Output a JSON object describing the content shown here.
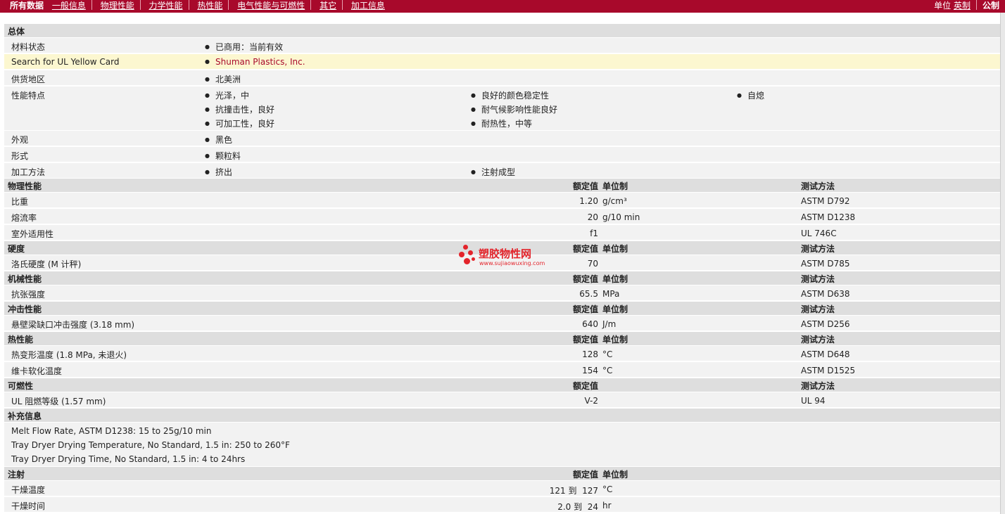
{
  "nav": {
    "all": "所有数据",
    "tabs": [
      "一般信息",
      "物理性能",
      "力学性能",
      "热性能",
      "电气性能与可燃性",
      "其它",
      "加工信息"
    ],
    "units_label": "单位",
    "imperial": "英制",
    "metric": "公制"
  },
  "headers": {
    "nominal": "额定值",
    "unit": "单位制",
    "method": "测试方法"
  },
  "general": {
    "title": "总体",
    "material_status": {
      "label": "材料状态",
      "value": "已商用：当前有效"
    },
    "ul_card": {
      "label": "Search for UL Yellow Card",
      "value": "Shuman Plastics, Inc."
    },
    "region": {
      "label": "供货地区",
      "value": "北美洲"
    },
    "features": {
      "label": "性能特点",
      "values": [
        "光泽，中",
        "抗撞击性，良好",
        "可加工性，良好",
        "良好的颜色稳定性",
        "耐气候影响性能良好",
        "耐热性，中等",
        "自熄"
      ]
    },
    "appearance": {
      "label": "外观",
      "value": "黑色"
    },
    "form": {
      "label": "形式",
      "value": "颗粒料"
    },
    "processing": {
      "label": "加工方法",
      "values": [
        "挤出",
        "注射成型"
      ]
    }
  },
  "physical": {
    "title": "物理性能",
    "rows": [
      {
        "label": "比重",
        "value": "1.20",
        "unit": "g/cm³",
        "method": "ASTM D792"
      },
      {
        "label": "熔流率",
        "value": "20",
        "unit": "g/10 min",
        "method": "ASTM D1238"
      },
      {
        "label": "室外适用性",
        "value": "f1",
        "unit": "",
        "method": "UL 746C"
      }
    ]
  },
  "hardness": {
    "title": "硬度",
    "rows": [
      {
        "label": "洛氏硬度 (M 计秤)",
        "value": "70",
        "unit": "",
        "method": "ASTM D785"
      }
    ]
  },
  "mechanical": {
    "title": "机械性能",
    "rows": [
      {
        "label": "抗张强度",
        "value": "65.5",
        "unit": "MPa",
        "method": "ASTM D638"
      }
    ]
  },
  "impact": {
    "title": "冲击性能",
    "rows": [
      {
        "label": "悬壁梁缺口冲击强度 (3.18 mm)",
        "value": "640",
        "unit": "J/m",
        "method": "ASTM D256"
      }
    ]
  },
  "thermal": {
    "title": "热性能",
    "rows": [
      {
        "label": "热变形温度 (1.8 MPa, 未退火)",
        "value": "128",
        "unit": "°C",
        "method": "ASTM D648"
      },
      {
        "label": "维卡软化温度",
        "value": "154",
        "unit": "°C",
        "method": "ASTM D1525"
      }
    ]
  },
  "flammability": {
    "title": "可燃性",
    "rows": [
      {
        "label": "UL 阻燃等级 (1.57 mm)",
        "value": "V-2",
        "method": "UL 94"
      }
    ]
  },
  "supplementary": {
    "title": "补充信息",
    "lines": [
      "Melt Flow Rate, ASTM D1238: 15 to 25g/10 min",
      "Tray Dryer Drying Temperature, No Standard, 1.5 in: 250 to 260°F",
      "Tray Dryer Drying Time, No Standard, 1.5 in: 4 to 24hrs"
    ]
  },
  "injection": {
    "title": "注射",
    "rows": [
      {
        "label": "干燥温度",
        "value": "121 到  127",
        "unit": "°C"
      },
      {
        "label": "干燥时间",
        "value": "2.0 到  24",
        "unit": "hr"
      }
    ]
  },
  "watermark": {
    "text": "塑胶物性网",
    "url": "www.sujiaowuxing.com"
  },
  "colors": {
    "brand": "#a8092b",
    "header_bg": "#dedede",
    "row_bg": "#f2f2f2",
    "highlight": "#fcf7d0"
  }
}
